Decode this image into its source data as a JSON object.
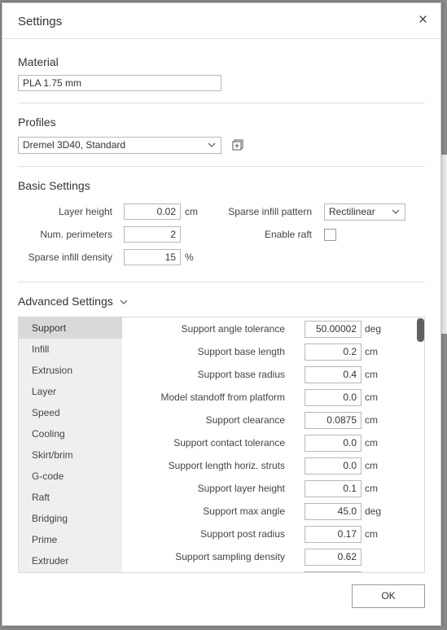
{
  "dialog": {
    "title": "Settings",
    "close_glyph": "×"
  },
  "material": {
    "heading": "Material",
    "value": "PLA 1.75 mm"
  },
  "profiles": {
    "heading": "Profiles",
    "selected": "Dremel 3D40, Standard",
    "action_icon": "add-profile-icon"
  },
  "basic": {
    "heading": "Basic Settings",
    "layer_height": {
      "label": "Layer height",
      "value": "0.02",
      "unit": "cm"
    },
    "num_perimeters": {
      "label": "Num. perimeters",
      "value": "2"
    },
    "sparse_density": {
      "label": "Sparse infill density",
      "value": "15",
      "unit": "%"
    },
    "sparse_pattern": {
      "label": "Sparse infill pattern",
      "value": "Rectilinear"
    },
    "enable_raft": {
      "label": "Enable raft",
      "checked": false
    }
  },
  "advanced": {
    "heading": "Advanced Settings",
    "categories": [
      "Support",
      "Infill",
      "Extrusion",
      "Layer",
      "Speed",
      "Cooling",
      "Skirt/brim",
      "G-code",
      "Raft",
      "Bridging",
      "Prime",
      "Extruder"
    ],
    "selected_category": "Support",
    "params": [
      {
        "label": "Support angle tolerance",
        "value": "50.00002",
        "unit": "deg"
      },
      {
        "label": "Support base length",
        "value": "0.2",
        "unit": "cm"
      },
      {
        "label": "Support base radius",
        "value": "0.4",
        "unit": "cm"
      },
      {
        "label": "Model standoff from platform",
        "value": "0.0",
        "unit": "cm"
      },
      {
        "label": "Support clearance",
        "value": "0.0875",
        "unit": "cm"
      },
      {
        "label": "Support contact tolerance",
        "value": "0.0",
        "unit": "cm"
      },
      {
        "label": "Support length horiz. struts",
        "value": "0.0",
        "unit": "cm"
      },
      {
        "label": "Support layer height",
        "value": "0.1",
        "unit": "cm"
      },
      {
        "label": "Support max angle",
        "value": "45.0",
        "unit": "deg"
      },
      {
        "label": "Support post radius",
        "value": "0.17",
        "unit": "cm"
      },
      {
        "label": "Support sampling density",
        "value": "0.62",
        "unit": ""
      }
    ]
  },
  "footer": {
    "ok_label": "OK"
  }
}
